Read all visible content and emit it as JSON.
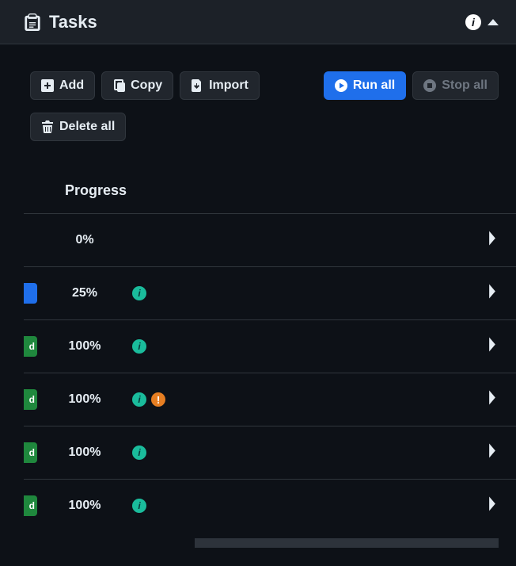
{
  "header": {
    "title": "Tasks",
    "info_letter": "i"
  },
  "toolbar": {
    "add": "Add",
    "copy": "Copy",
    "import": "Import",
    "run_all": "Run all",
    "stop_all": "Stop all",
    "delete_all": "Delete all"
  },
  "columns": {
    "progress": "Progress"
  },
  "icons": {
    "info": "i",
    "warn": "!"
  },
  "rows": [
    {
      "status_text": "",
      "status_color": "none",
      "progress": "0%",
      "info": false,
      "warn": false
    },
    {
      "status_text": "",
      "status_color": "blue",
      "progress": "25%",
      "info": true,
      "warn": false
    },
    {
      "status_text": "d",
      "status_color": "green",
      "progress": "100%",
      "info": true,
      "warn": false
    },
    {
      "status_text": "d",
      "status_color": "green",
      "progress": "100%",
      "info": true,
      "warn": true
    },
    {
      "status_text": "d",
      "status_color": "green",
      "progress": "100%",
      "info": true,
      "warn": false
    },
    {
      "status_text": "d",
      "status_color": "green",
      "progress": "100%",
      "info": true,
      "warn": false
    }
  ]
}
